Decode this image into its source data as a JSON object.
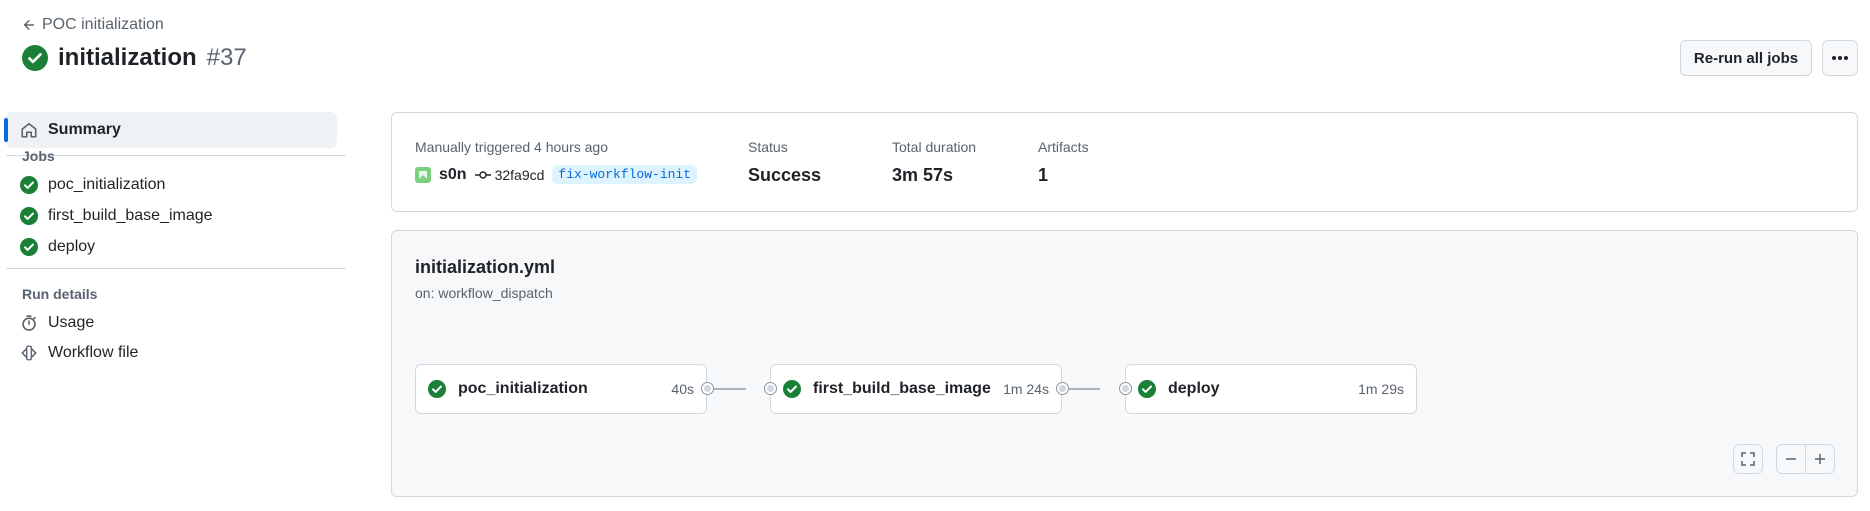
{
  "header": {
    "back_label": "POC initialization",
    "run_name": "initialization",
    "run_number": "#37",
    "rerun_label": "Re-run all jobs"
  },
  "sidebar": {
    "summary_label": "Summary",
    "jobs_heading": "Jobs",
    "jobs": [
      {
        "label": "poc_initialization"
      },
      {
        "label": "first_build_base_image"
      },
      {
        "label": "deploy"
      }
    ],
    "run_details_heading": "Run details",
    "details": [
      {
        "label": "Usage"
      },
      {
        "label": "Workflow file"
      }
    ]
  },
  "summary": {
    "trigger_text": "Manually triggered 4 hours ago",
    "actor": "s0n",
    "commit": "32fa9cd",
    "branch": "fix-workflow-init",
    "status_label": "Status",
    "status_value": "Success",
    "duration_label": "Total duration",
    "duration_value": "3m 57s",
    "artifacts_label": "Artifacts",
    "artifacts_value": "1"
  },
  "workflow": {
    "file": "initialization.yml",
    "trigger": "on: workflow_dispatch",
    "jobs": [
      {
        "name": "poc_initialization",
        "duration": "40s"
      },
      {
        "name": "first_build_base_image",
        "duration": "1m 24s"
      },
      {
        "name": "deploy",
        "duration": "1m 29s"
      }
    ]
  },
  "colors": {
    "success": "#1a7f37",
    "accent": "#0969da"
  },
  "icons": [
    "arrow-left-icon",
    "check-circle-icon",
    "kebab-horizontal-icon",
    "home-icon",
    "stopwatch-icon",
    "workflow-file-icon",
    "commit-icon",
    "fullscreen-icon",
    "zoom-out-icon",
    "zoom-in-icon"
  ]
}
